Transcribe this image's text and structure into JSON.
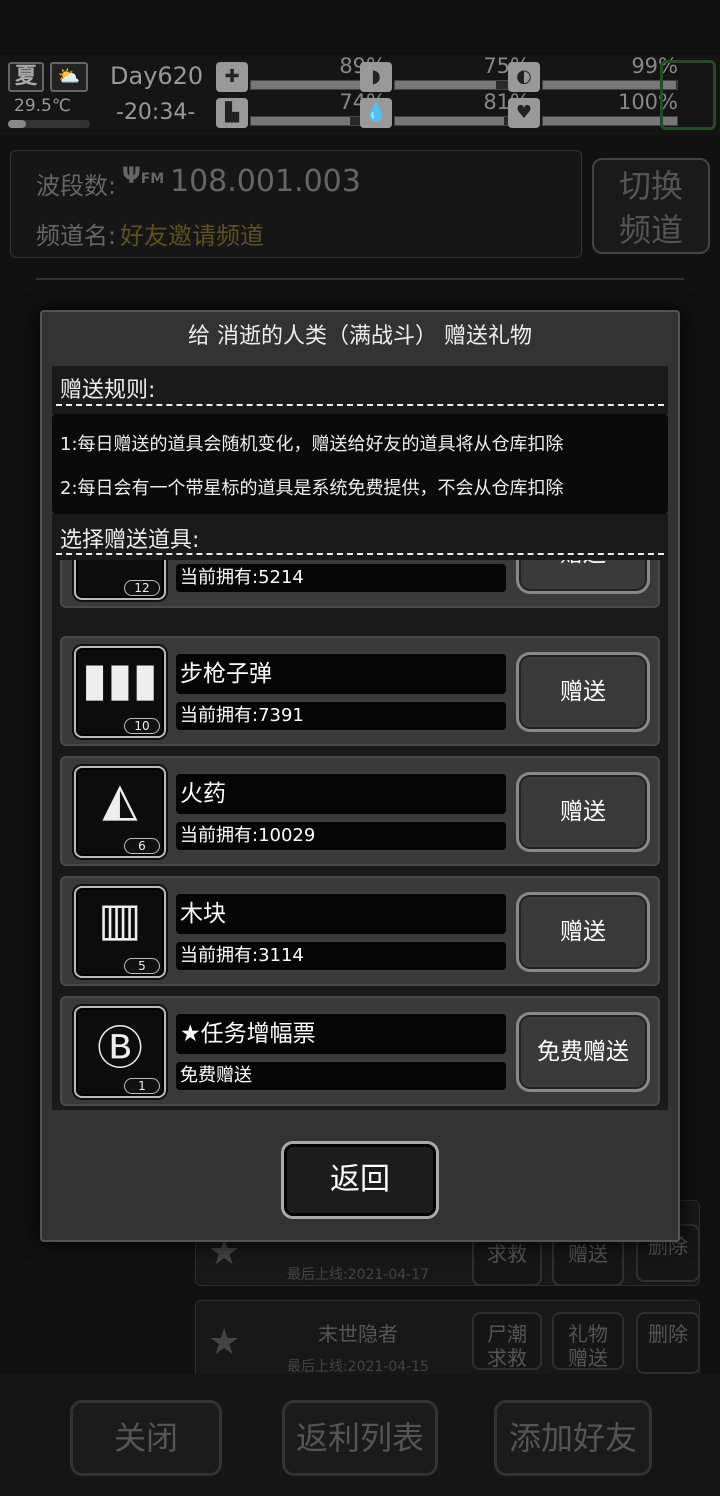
{
  "status": {
    "season": "夏",
    "weather_icon": "cloud-sun-icon",
    "temperature": "29.5℃",
    "temperature_level": 0.22,
    "day": "Day620",
    "time": "-20:34-",
    "stats": [
      {
        "icon": "medkit-icon",
        "glyph": "✚",
        "value": "89%",
        "level": 0.89
      },
      {
        "icon": "stomach-icon",
        "glyph": "◗",
        "value": "75%",
        "level": 0.75
      },
      {
        "icon": "pill-icon",
        "glyph": "◐",
        "value": "99%",
        "level": 0.99
      },
      {
        "icon": "boot-icon",
        "glyph": "▙",
        "value": "74%",
        "level": 0.74
      },
      {
        "icon": "water-drop-icon",
        "glyph": "💧",
        "value": "81%",
        "level": 0.81
      },
      {
        "icon": "heart-icon",
        "glyph": "♥",
        "value": "100%",
        "level": 1.0
      }
    ]
  },
  "channel": {
    "band_label": "波段数:",
    "frequency": "108.001.003",
    "fm_icon": "FM",
    "name_label": "频道名:",
    "name_value": "好友邀请频道",
    "switch_button": "切换\n频道"
  },
  "background_rows": [
    {
      "name": "",
      "last_online": "最后上线:2021-04-17",
      "btn1": "求救",
      "btn2": "赠送",
      "btn3": "删除"
    },
    {
      "name": "末世隐者",
      "last_online": "最后上线:2021-04-15",
      "btn1": "尸潮\n求救",
      "btn2": "礼物\n赠送",
      "btn3": "删除"
    }
  ],
  "bottom_buttons": {
    "close": "关闭",
    "rebate": "返利列表",
    "add_friend": "添加好友"
  },
  "dialog": {
    "title": "给 消逝的人类（满战斗） 赠送礼物",
    "rules_title": "赠送规则:",
    "rules": [
      "1:每日赠送的道具会随机变化，赠送给好友的道具将从仓库扣除",
      "2:每日会有一个带星标的道具是系统免费提供，不会从仓库扣除"
    ],
    "select_title": "选择赠送道具:",
    "items": [
      {
        "icon": "bandage-icon",
        "glyph": "✕",
        "badge": "12",
        "name": "",
        "owned": "当前拥有:5214",
        "button": "赠送"
      },
      {
        "icon": "rifle-bullets-icon",
        "glyph": "▮▮▮",
        "badge": "10",
        "name": "步枪子弹",
        "owned": "当前拥有:7391",
        "button": "赠送"
      },
      {
        "icon": "gunpowder-icon",
        "glyph": "◭",
        "badge": "6",
        "name": "火药",
        "owned": "当前拥有:10029",
        "button": "赠送"
      },
      {
        "icon": "wood-block-icon",
        "glyph": "▥",
        "badge": "5",
        "name": "木块",
        "owned": "当前拥有:3114",
        "button": "赠送"
      },
      {
        "icon": "mission-ticket-icon",
        "glyph": "Ⓑ",
        "badge": "1",
        "name": "★任务增幅票",
        "owned": "免费赠送",
        "button": "免费赠送"
      }
    ],
    "back_button": "返回"
  }
}
